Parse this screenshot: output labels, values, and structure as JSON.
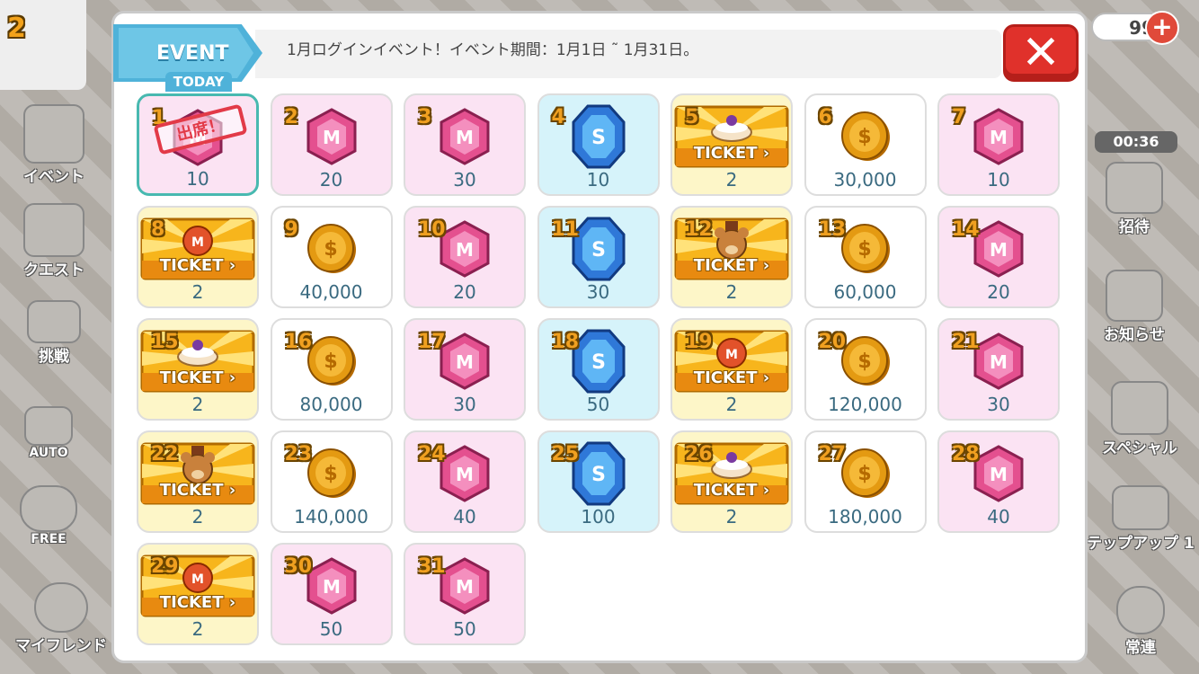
{
  "background": {
    "level": "2",
    "currency_count": "99",
    "timer": "00:36",
    "left_menu": [
      "イベント",
      "クエスト",
      "挑戦",
      "AUTO",
      "FREE",
      "マイフレンド"
    ],
    "right_menu": [
      "招待",
      "お知らせ",
      "スペシャル",
      "テップアップ 1",
      "常連"
    ]
  },
  "event": {
    "tag": "EVENT",
    "today": "TODAY",
    "title": "1月ログインイベント！イベント期間：1月1日 ˜ 1月31日。",
    "close": "✕",
    "attended_stamp": "出席！",
    "ticket_word": "TICKET"
  },
  "rewards": [
    {
      "day": "1",
      "type": "gem-m",
      "amount": "10",
      "today": true
    },
    {
      "day": "2",
      "type": "gem-m",
      "amount": "20"
    },
    {
      "day": "3",
      "type": "gem-m",
      "amount": "30"
    },
    {
      "day": "4",
      "type": "gem-s",
      "amount": "10"
    },
    {
      "day": "5",
      "type": "ticket-cake",
      "amount": "2"
    },
    {
      "day": "6",
      "type": "coin",
      "amount": "30,000"
    },
    {
      "day": "7",
      "type": "gem-m",
      "amount": "10"
    },
    {
      "day": "8",
      "type": "ticket-m",
      "amount": "2"
    },
    {
      "day": "9",
      "type": "coin",
      "amount": "40,000"
    },
    {
      "day": "10",
      "type": "gem-m",
      "amount": "20"
    },
    {
      "day": "11",
      "type": "gem-s",
      "amount": "30"
    },
    {
      "day": "12",
      "type": "ticket-bear",
      "amount": "2"
    },
    {
      "day": "13",
      "type": "coin",
      "amount": "60,000"
    },
    {
      "day": "14",
      "type": "gem-m",
      "amount": "20"
    },
    {
      "day": "15",
      "type": "ticket-cake",
      "amount": "2"
    },
    {
      "day": "16",
      "type": "coin",
      "amount": "80,000"
    },
    {
      "day": "17",
      "type": "gem-m",
      "amount": "30"
    },
    {
      "day": "18",
      "type": "gem-s",
      "amount": "50"
    },
    {
      "day": "19",
      "type": "ticket-m",
      "amount": "2"
    },
    {
      "day": "20",
      "type": "coin",
      "amount": "120,000"
    },
    {
      "day": "21",
      "type": "gem-m",
      "amount": "30"
    },
    {
      "day": "22",
      "type": "ticket-bear",
      "amount": "2"
    },
    {
      "day": "23",
      "type": "coin",
      "amount": "140,000"
    },
    {
      "day": "24",
      "type": "gem-m",
      "amount": "40"
    },
    {
      "day": "25",
      "type": "gem-s",
      "amount": "100"
    },
    {
      "day": "26",
      "type": "ticket-cake",
      "amount": "2"
    },
    {
      "day": "27",
      "type": "coin",
      "amount": "180,000"
    },
    {
      "day": "28",
      "type": "gem-m",
      "amount": "40"
    },
    {
      "day": "29",
      "type": "ticket-m",
      "amount": "2"
    },
    {
      "day": "30",
      "type": "gem-m",
      "amount": "50"
    },
    {
      "day": "31",
      "type": "gem-m",
      "amount": "50"
    }
  ],
  "colors": {
    "gem_m": "#e4508f",
    "gem_s": "#2f78d8",
    "coin": "#e49a12",
    "ticket": "#f7b51c",
    "accent": "#4fb2d9",
    "close": "#e0312b"
  }
}
